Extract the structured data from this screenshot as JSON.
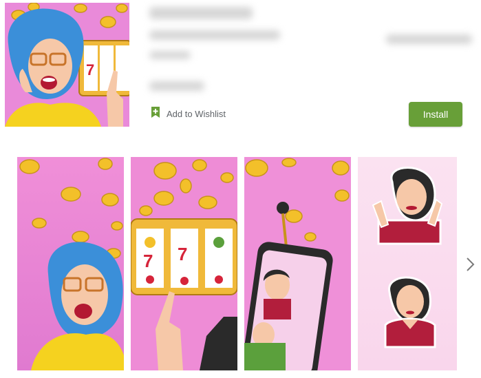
{
  "actions": {
    "wishlist_label": "Add to Wishlist",
    "install_label": "Install"
  },
  "colors": {
    "accent_green": "#689f38",
    "icon_text_gray": "#5f6368",
    "pink_bg": "#e98ad9",
    "coin_gold": "#f3c02a",
    "hair_blue": "#3b8fd9",
    "shirt_yellow": "#f5d21f",
    "jacket_red": "#b21e3c"
  },
  "icons": {
    "wishlist": "bookmark-plus-icon",
    "next": "chevron-right-icon"
  }
}
